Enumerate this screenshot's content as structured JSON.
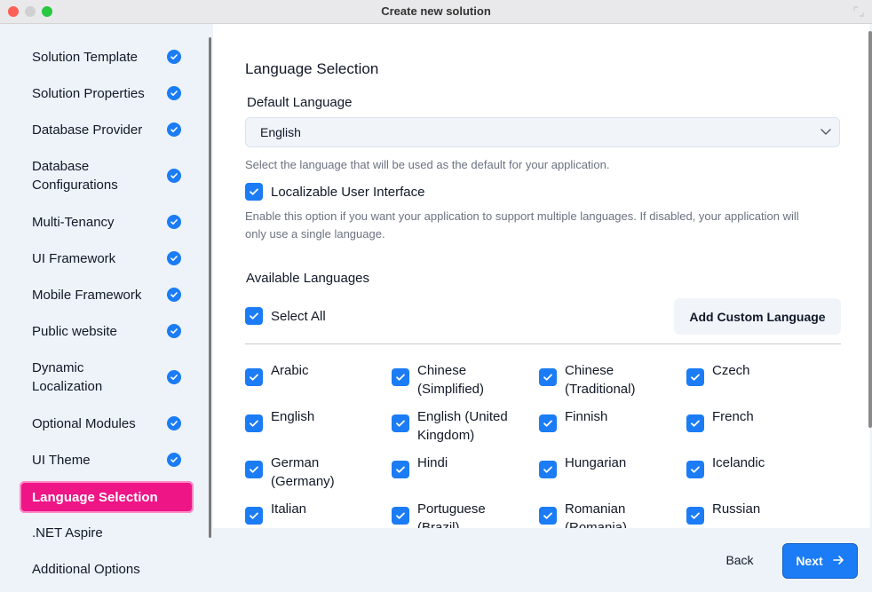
{
  "window": {
    "title": "Create new solution"
  },
  "sidebar": {
    "items": [
      {
        "label": "Solution Template",
        "done": true
      },
      {
        "label": "Solution Properties",
        "done": true
      },
      {
        "label": "Database Provider",
        "done": true
      },
      {
        "label": "Database Configurations",
        "done": true
      },
      {
        "label": "Multi-Tenancy",
        "done": true
      },
      {
        "label": "UI Framework",
        "done": true
      },
      {
        "label": "Mobile Framework",
        "done": true
      },
      {
        "label": "Public website",
        "done": true
      },
      {
        "label": "Dynamic Localization",
        "done": true
      },
      {
        "label": "Optional Modules",
        "done": true
      },
      {
        "label": "UI Theme",
        "done": true
      },
      {
        "label": "Language Selection",
        "active": true
      },
      {
        "label": ".NET Aspire"
      },
      {
        "label": "Additional Options"
      }
    ]
  },
  "main": {
    "title": "Language Selection",
    "default_language_label": "Default Language",
    "default_language_value": "English",
    "default_language_hint": "Select the language that will be used as the default for your application.",
    "localizable_ui_label": "Localizable User Interface",
    "localizable_ui_checked": true,
    "localizable_ui_hint": "Enable this option if you want your application to support multiple languages. If disabled, your application will only use a single language.",
    "available_languages_label": "Available Languages",
    "select_all_label": "Select All",
    "select_all_checked": true,
    "add_custom_language_label": "Add Custom Language",
    "languages": [
      {
        "label": "Arabic",
        "checked": true
      },
      {
        "label": "Chinese (Simplified)",
        "checked": true
      },
      {
        "label": "Chinese (Traditional)",
        "checked": true
      },
      {
        "label": "Czech",
        "checked": true
      },
      {
        "label": "English",
        "checked": true
      },
      {
        "label": "English (United Kingdom)",
        "checked": true
      },
      {
        "label": "Finnish",
        "checked": true
      },
      {
        "label": "French",
        "checked": true
      },
      {
        "label": "German (Germany)",
        "checked": true
      },
      {
        "label": "Hindi",
        "checked": true
      },
      {
        "label": "Hungarian",
        "checked": true
      },
      {
        "label": "Icelandic",
        "checked": true
      },
      {
        "label": "Italian",
        "checked": true
      },
      {
        "label": "Portuguese (Brazil)",
        "checked": true
      },
      {
        "label": "Romanian (Romania)",
        "checked": true
      },
      {
        "label": "Russian",
        "checked": true
      }
    ]
  },
  "footer": {
    "back_label": "Back",
    "next_label": "Next"
  },
  "colors": {
    "accent": "#1b7cf5",
    "active_item": "#ee1586"
  }
}
